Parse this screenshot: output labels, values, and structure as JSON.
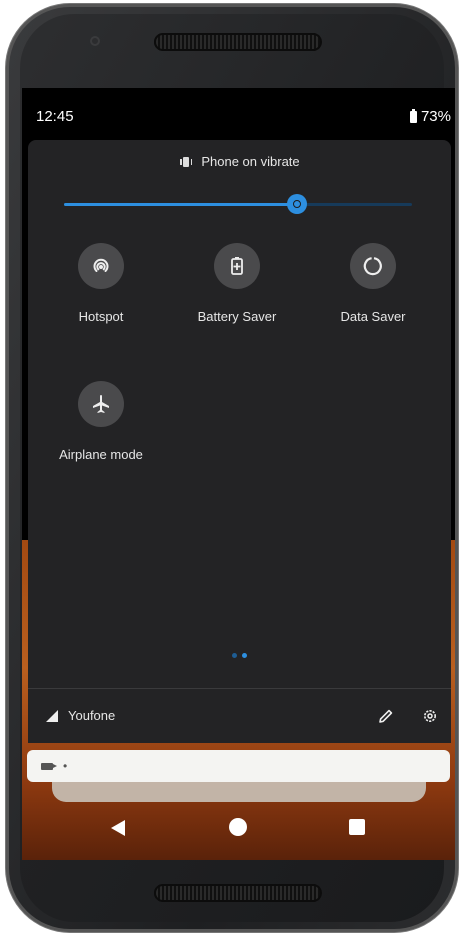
{
  "status_bar": {
    "time": "12:45",
    "battery": "73%"
  },
  "quick_settings": {
    "ringer_label": "Phone on vibrate",
    "brightness_level": 0.67,
    "tiles": [
      {
        "label": "Hotspot",
        "icon": "hotspot-icon"
      },
      {
        "label": "Battery Saver",
        "icon": "battery-saver-icon"
      },
      {
        "label": "Data Saver",
        "icon": "data-saver-icon"
      },
      {
        "label": "Airplane mode",
        "icon": "airplane-icon"
      }
    ],
    "pages": 2,
    "active_page": 2,
    "carrier": "Youfone"
  },
  "notification": {
    "icon": "video-camera-icon",
    "text": "•"
  },
  "colors": {
    "accent": "#2d8fe0",
    "panel": "#232325",
    "tile": "#4a4a4c"
  }
}
